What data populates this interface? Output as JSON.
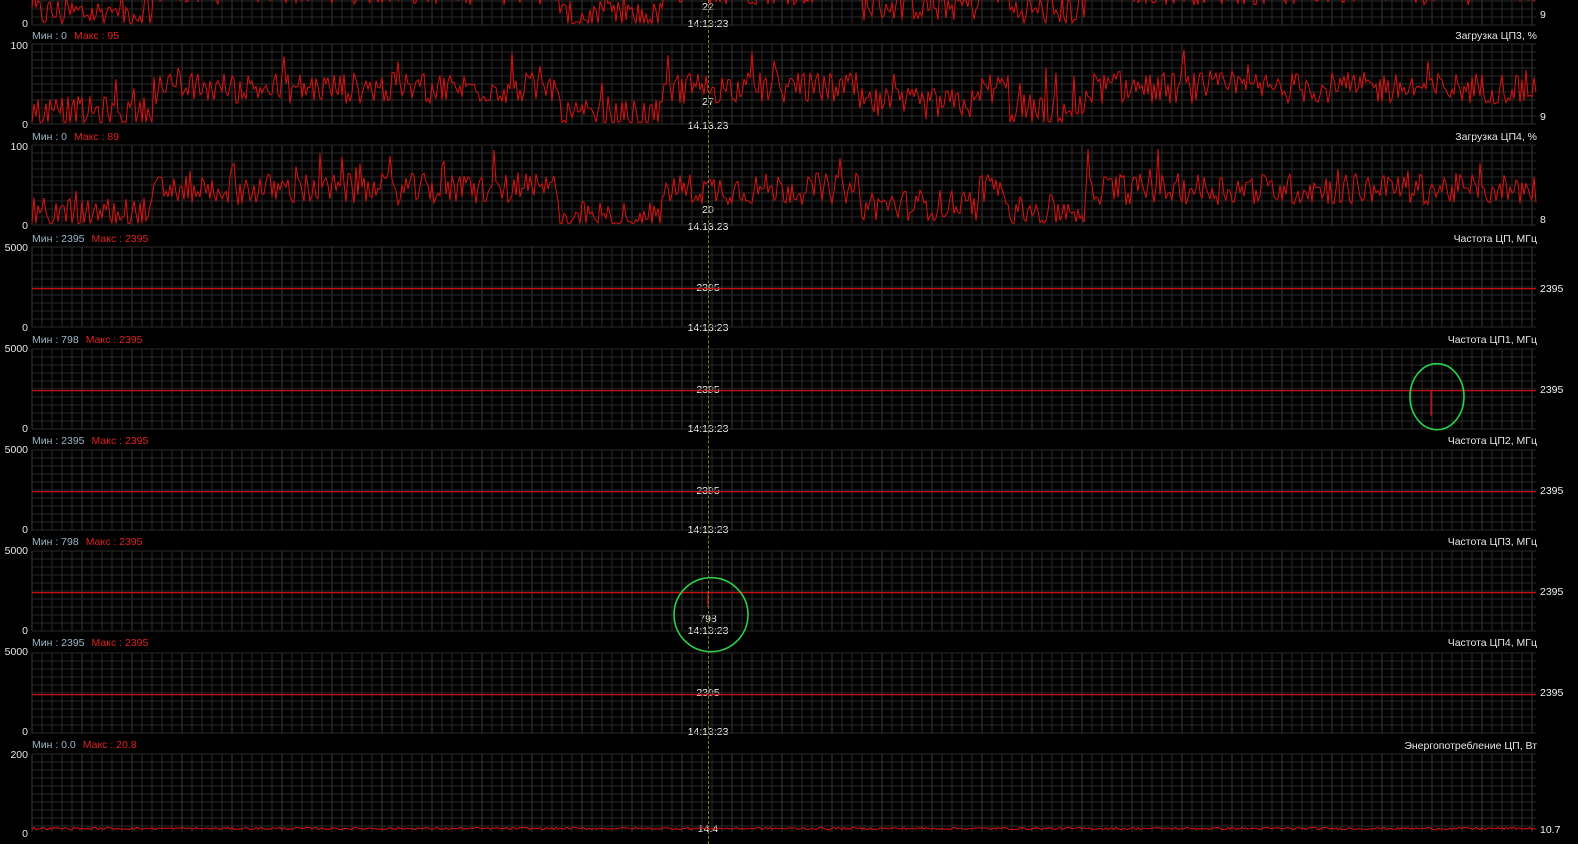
{
  "cursor": {
    "time": "14:13:23"
  },
  "graphs": [
    {
      "id": "g0",
      "title": "",
      "min_label": "",
      "max_label": "",
      "ymax": "",
      "ymin": "0",
      "cursor_value": "22",
      "current_value": "9",
      "type": "noise",
      "baseline_value": 45
    },
    {
      "id": "g1",
      "title": "Загрузка ЦП3, %",
      "min_label": "Мин : 0",
      "max_label": "Макс : 95",
      "ymax": "100",
      "ymin": "0",
      "cursor_value": "27",
      "current_value": "9",
      "type": "noise",
      "baseline_value": 45
    },
    {
      "id": "g2",
      "title": "Загрузка ЦП4, %",
      "min_label": "Мин : 0",
      "max_label": "Макс : 89",
      "ymax": "100",
      "ymin": "0",
      "cursor_value": "20",
      "current_value": "8",
      "type": "noise",
      "baseline_value": 40
    },
    {
      "id": "g3",
      "title": "Частота ЦП, МГц",
      "min_label": "Мин : 2395",
      "max_label": "Макс : 2395",
      "ymax": "5000",
      "ymin": "0",
      "cursor_value": "2395",
      "current_value": "2395",
      "type": "flat",
      "baseline_value": 2395
    },
    {
      "id": "g4",
      "title": "Частота ЦП1, МГц",
      "min_label": "Мин : 798",
      "max_label": "Макс : 2395",
      "ymax": "5000",
      "ymin": "0",
      "cursor_value": "2395",
      "current_value": "2395",
      "type": "flat",
      "baseline_value": 2395,
      "dip_value": 798
    },
    {
      "id": "g5",
      "title": "Частота ЦП2, МГц",
      "min_label": "Мин : 2395",
      "max_label": "Макс : 2395",
      "ymax": "5000",
      "ymin": "0",
      "cursor_value": "2395",
      "current_value": "2395",
      "type": "flat",
      "baseline_value": 2395
    },
    {
      "id": "g6",
      "title": "Частота ЦП3, МГц",
      "min_label": "Мин : 798",
      "max_label": "Макс : 2395",
      "ymax": "5000",
      "ymin": "0",
      "cursor_value": "798",
      "current_value": "2395",
      "type": "flat",
      "baseline_value": 2395,
      "dip_value": 798
    },
    {
      "id": "g7",
      "title": "Частота ЦП4, МГц",
      "min_label": "Мин : 2395",
      "max_label": "Макс : 2395",
      "ymax": "5000",
      "ymin": "0",
      "cursor_value": "2395",
      "current_value": "2395",
      "type": "flat",
      "baseline_value": 2395
    },
    {
      "id": "g8",
      "title": "Энергопотребление ЦП, Вт",
      "min_label": "Мин : 0.0",
      "max_label": "Макс : 20.8",
      "ymax": "200",
      "ymin": "0",
      "cursor_value": "14.4",
      "current_value": "10.7",
      "type": "low",
      "baseline_value": 12
    }
  ],
  "colors": {
    "line": "#e01010",
    "grid": "#2a2a2a",
    "grid_major": "#3a3a3a",
    "annotation": "#2bd14a"
  }
}
